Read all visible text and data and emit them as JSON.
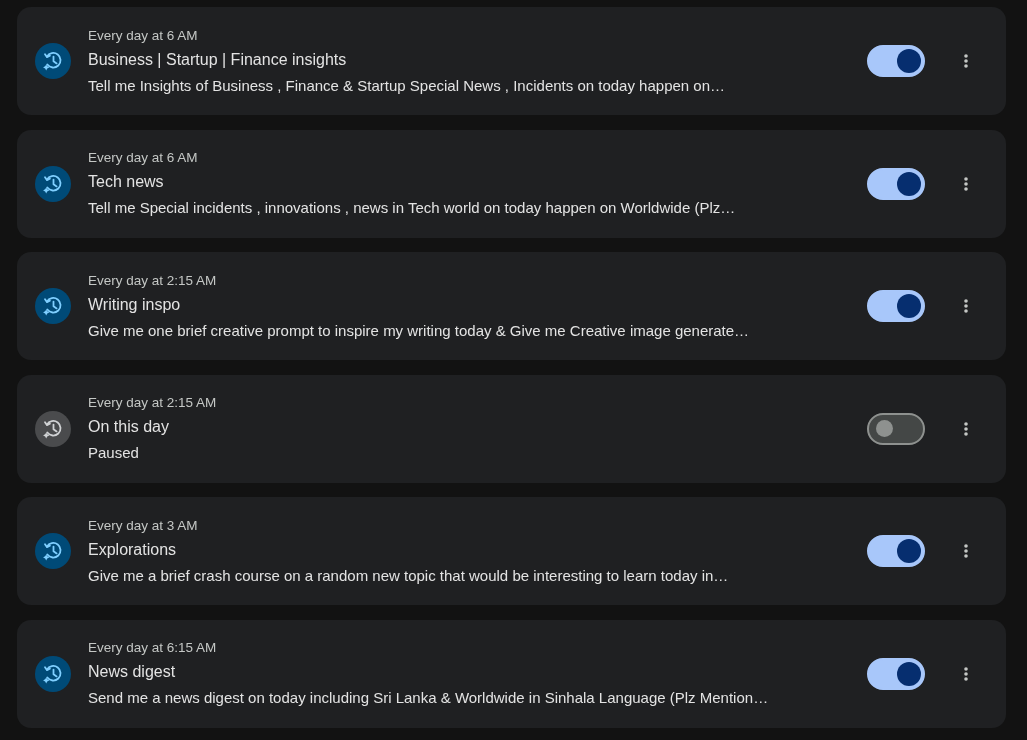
{
  "tasks": [
    {
      "schedule": "Every day at 6 AM",
      "title": "Business | Startup | Finance insights",
      "description": "Tell me Insights of Business , Finance & Startup Special News , Incidents on today happen on…",
      "on": true
    },
    {
      "schedule": "Every day at 6 AM",
      "title": "Tech news",
      "description": "Tell me Special incidents , innovations , news in Tech world on today happen on Worldwide (Plz…",
      "on": true
    },
    {
      "schedule": "Every day at 2:15 AM",
      "title": "Writing inspo",
      "description": "Give me one brief creative prompt to inspire my writing today & Give me Creative image generate…",
      "on": true
    },
    {
      "schedule": "Every day at 2:15 AM",
      "title": "On this day",
      "description": "Paused",
      "on": false
    },
    {
      "schedule": "Every day at 3 AM",
      "title": "Explorations",
      "description": "Give me a brief crash course on a random new topic that would be interesting to learn today in…",
      "on": true
    },
    {
      "schedule": "Every day at 6:15 AM",
      "title": "News digest",
      "description": "Send me a news digest on today including Sri Lanka & Worldwide in Sinhala Language (Plz Mention…",
      "on": true
    }
  ]
}
